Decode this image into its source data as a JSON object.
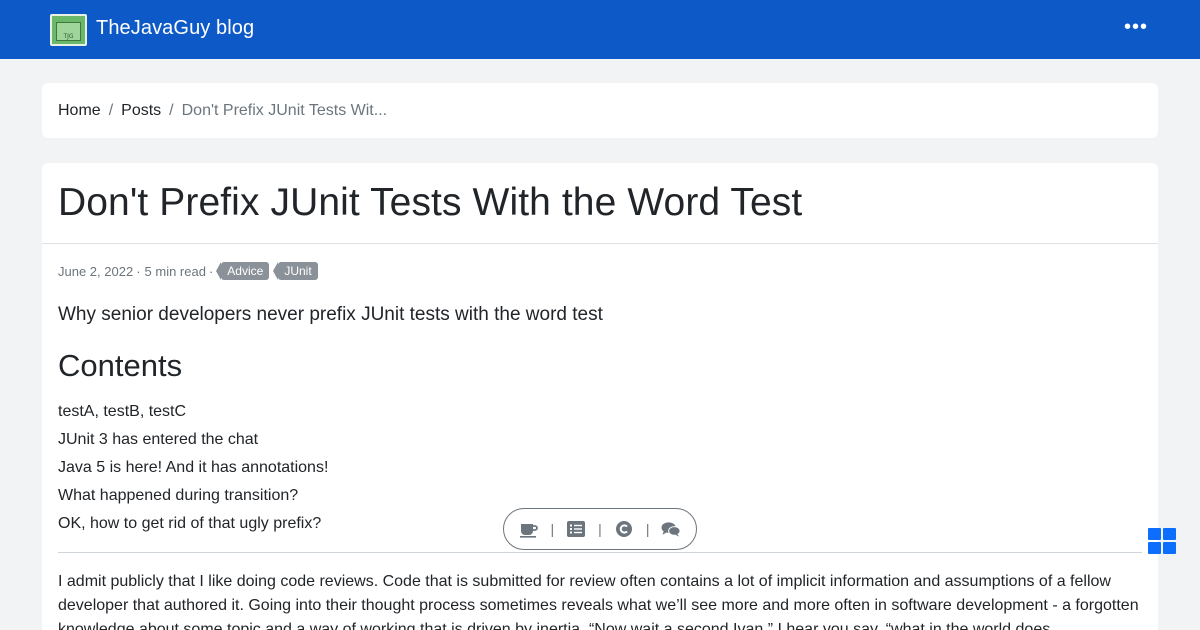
{
  "navbar": {
    "logo_text": "TJG",
    "brand": "TheJavaGuy blog",
    "more_label": "•••",
    "colors": {
      "background": "#0d59c8",
      "text": "#ffffff"
    }
  },
  "breadcrumb": {
    "home": "Home",
    "separator_1": "/",
    "posts": "Posts",
    "separator_2": "/",
    "current": "Don't Prefix JUnit Tests Wit..."
  },
  "article": {
    "title": "Don't Prefix JUnit Tests With the Word Test",
    "date": "June 2, 2022",
    "dot_1": "·",
    "read_time": "5 min read",
    "dot_2": "·",
    "tags": [
      "Advice",
      "JUnit"
    ],
    "lead": "Why senior developers never prefix JUnit tests with the word test",
    "contents_heading": "Contents",
    "toc": [
      "testA, testB, testC",
      "JUnit 3 has entered the chat",
      "Java 5 is here! And it has annotations!",
      "What happened during transition?",
      "OK, how to get rid of that ugly prefix?"
    ],
    "paragraph": "I admit publicly that I like doing code reviews. Code that is submitted for review often contains a lot of implicit information and assumptions of a fellow developer that authored it. Going into their thought process sometimes reveals what we’ll see more and more often in software development - a forgotten knowledge about some topic and a way of working that is driven by inertia. “Now wait a second Ivan,” I hear you say, “what in the world does"
  },
  "floating_toolbar": {
    "icons": [
      "coffee-icon",
      "list-icon",
      "copyright-icon",
      "comments-icon"
    ],
    "separator": "|"
  },
  "corner_widget": {
    "icon": "windows-grid-icon",
    "color": "#0d6efd"
  }
}
